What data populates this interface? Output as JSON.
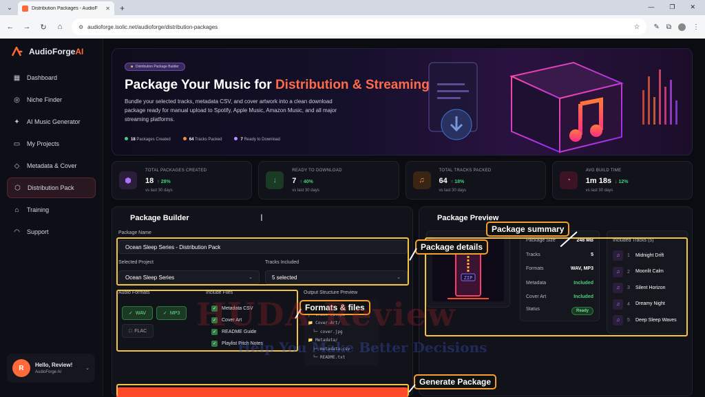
{
  "browser": {
    "tab_title": "Distribution Packages - AudioF",
    "url": "audioforge.isolic.net/audioforge/distribution-packages"
  },
  "app": {
    "logo_main": "AudioForge",
    "logo_ai": "AI"
  },
  "sidebar": {
    "items": [
      {
        "label": "Dashboard",
        "icon": "grid-icon"
      },
      {
        "label": "Niche Finder",
        "icon": "compass-icon"
      },
      {
        "label": "AI Music Generator",
        "icon": "sparkle-icon"
      },
      {
        "label": "My Projects",
        "icon": "folder-icon"
      },
      {
        "label": "Metadata & Cover",
        "icon": "tag-icon"
      },
      {
        "label": "Distribution Pack",
        "icon": "box-icon",
        "active": true
      },
      {
        "label": "Training",
        "icon": "graduation-icon"
      },
      {
        "label": "Support",
        "icon": "headset-icon"
      }
    ],
    "user": {
      "initial": "R",
      "greeting": "Hello, Review!",
      "sub": "AudioForge AI"
    }
  },
  "hero": {
    "badge": "Distribution Package Builder",
    "title_plain": "Package Your Music for ",
    "title_highlight": "Distribution & Streaming",
    "description": "Bundle your selected tracks, metadata CSV, and cover artwork into a clean download package ready for manual upload to Spotify, Apple Music, Amazon Music, and all major streaming platforms.",
    "stats": [
      {
        "value": "18",
        "label": "Packages Created",
        "color": "#3ed07a"
      },
      {
        "value": "64",
        "label": "Tracks Packed",
        "color": "#ff8a3a"
      },
      {
        "value": "7",
        "label": "Ready to Download",
        "color": "#b890ff"
      }
    ]
  },
  "stats": [
    {
      "label": "TOTAL PACKAGES CREATED",
      "value": "18",
      "trend": "↑ 28%",
      "sub": "vs last 30 days",
      "icon": "hexagon-icon",
      "icon_bg": "#2a1e3a",
      "icon_color": "#b070ff"
    },
    {
      "label": "READY TO DOWNLOAD",
      "value": "7",
      "trend": "↑ 40%",
      "sub": "vs last 30 days",
      "icon": "download-icon",
      "icon_bg": "#1a3a24",
      "icon_color": "#4ad07a"
    },
    {
      "label": "TOTAL TRACKS PACKED",
      "value": "64",
      "trend": "↑ 18%",
      "sub": "vs last 30 days",
      "icon": "music-note-icon",
      "icon_bg": "#3a2414",
      "icon_color": "#ff8a3a"
    },
    {
      "label": "AVG BUILD TIME",
      "value": "1m 18s",
      "trend": "↓ 12%",
      "sub": "vs last 30 days",
      "icon": "timer-icon",
      "icon_bg": "#3a1424",
      "icon_color": "#ff4a8a"
    }
  ],
  "builder": {
    "title": "Package Builder",
    "package_name_label": "Package Name",
    "package_name_value": "Ocean Sleep Series - Distribution Pack",
    "project_label": "Selected Project",
    "project_value": "Ocean Sleep Series",
    "tracks_label": "Tracks Included",
    "tracks_value": "5 selected",
    "formats_label": "Audio Formats",
    "formats": [
      {
        "label": "WAV",
        "on": true
      },
      {
        "label": "MP3",
        "on": true
      },
      {
        "label": "FLAC",
        "on": false
      }
    ],
    "include_label": "Include Files",
    "include_files": [
      "Metadata CSV",
      "Cover Art",
      "README Guide",
      "Playlist Pitch Notes"
    ],
    "output_label": "Output Structure Preview",
    "tree": [
      "├─ track-01.wav",
      "├─ track-01.mp3",
      "📁 Cover-Art/",
      "  └─ cover.jpg",
      "📁 Metadata/",
      "  ├─ metadata.csv",
      "  └─ README.txt"
    ]
  },
  "preview": {
    "title": "Package Preview",
    "summary": [
      {
        "label": "Package Size",
        "value": "248 MB"
      },
      {
        "label": "Tracks",
        "value": "5"
      },
      {
        "label": "Formats",
        "value": "WAV, MP3"
      },
      {
        "label": "Metadata",
        "value": "Included",
        "green": true
      },
      {
        "label": "Cover Art",
        "value": "Included",
        "green": true
      }
    ],
    "status_label": "Status",
    "status_value": "Ready",
    "tracks_title": "Included Tracks (5)",
    "tracks": [
      {
        "n": "1",
        "name": "Midnight Drift"
      },
      {
        "n": "2",
        "name": "Moonlit Calm"
      },
      {
        "n": "3",
        "name": "Silent Horizon"
      },
      {
        "n": "4",
        "name": "Dreamy Night"
      },
      {
        "n": "5",
        "name": "Deep Sleep Waves"
      }
    ],
    "zip_label": "ZIP"
  },
  "annotations": {
    "summary": "Package summary",
    "details": "Package details",
    "formats": "Formats & files",
    "generate": "Generate Package"
  },
  "watermark": {
    "big": "HUDA Review",
    "small": "Help You Make Better Decisions"
  }
}
